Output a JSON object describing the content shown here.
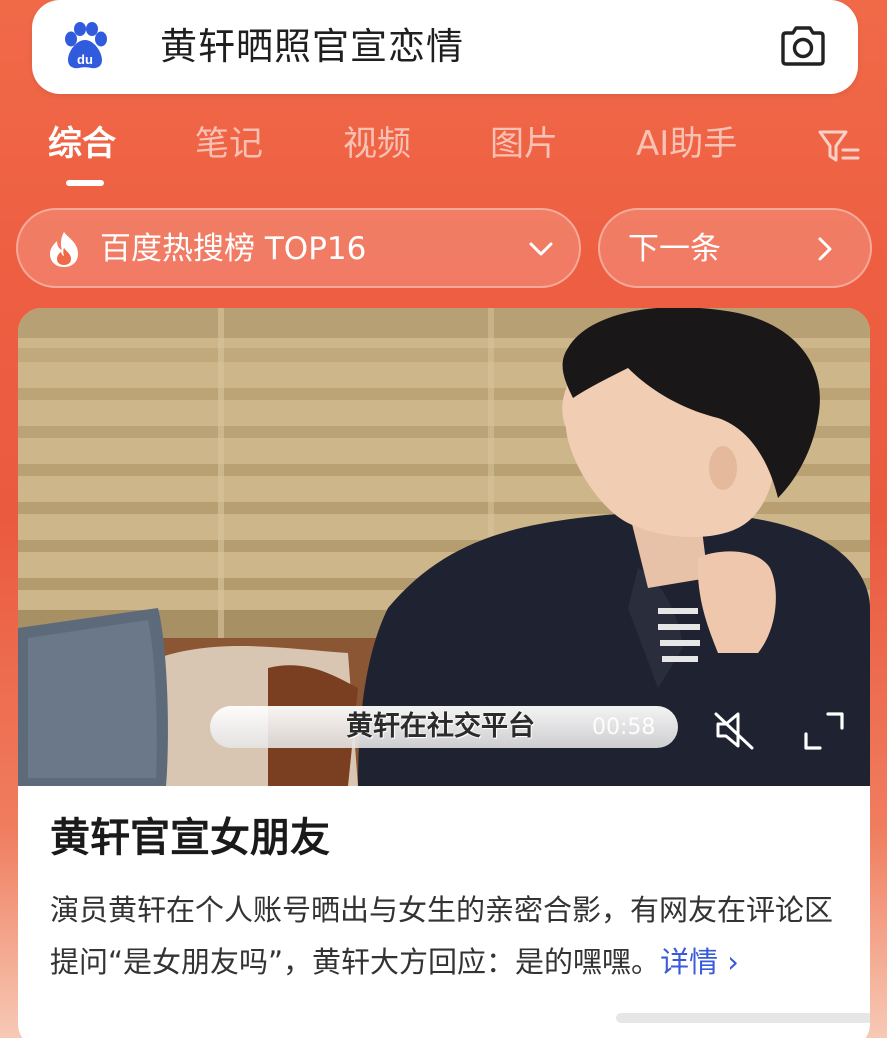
{
  "search": {
    "query": "黄轩晒照官宣恋情",
    "logo_icon": "baidu-paw-icon",
    "camera_icon": "camera-icon"
  },
  "tabs": [
    {
      "label": "综合",
      "active": true
    },
    {
      "label": "笔记",
      "active": false
    },
    {
      "label": "视频",
      "active": false
    },
    {
      "label": "图片",
      "active": false
    },
    {
      "label": "AI助手",
      "active": false
    }
  ],
  "filter_icon": "filter-icon",
  "hotlist": {
    "label": "百度热搜榜 TOP16",
    "icon": "flame-icon",
    "next_label": "下一条"
  },
  "card": {
    "video": {
      "subtitle": "黄轩在社交平台",
      "duration": "00:58"
    },
    "title": "黄轩官宣女朋友",
    "description": "演员黄轩在个人账号晒出与女生的亲密合影，有网友在评论区提问“是女朋友吗”，黄轩大方回应：是的嘿嘿。",
    "detail_link": "详情 ›"
  },
  "colors": {
    "accent": "#ea5a3f",
    "link": "#3a5bd9",
    "baidu_blue": "#2f5bdc"
  }
}
